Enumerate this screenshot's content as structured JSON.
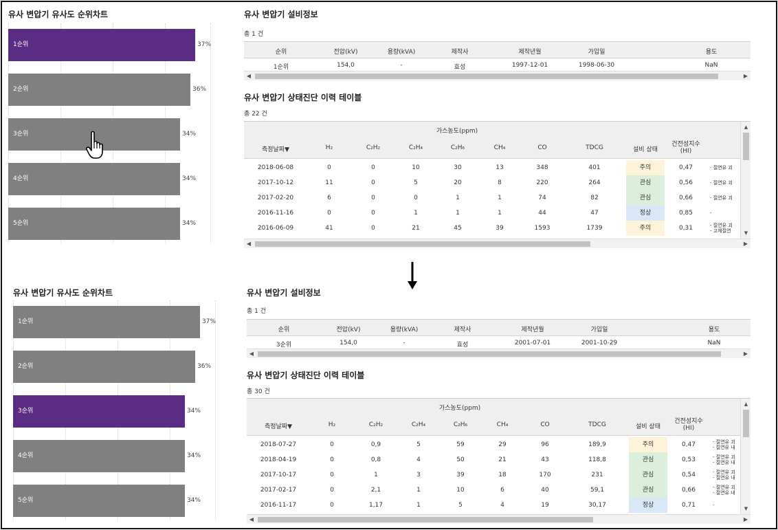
{
  "top": {
    "chart_title": "유사 변압기 유사도 순위차트",
    "chart": [
      {
        "label": "1순위",
        "pct": "37%",
        "value": 37,
        "selected": true
      },
      {
        "label": "2순위",
        "pct": "36%",
        "value": 36,
        "selected": false
      },
      {
        "label": "3순위",
        "pct": "34%",
        "value": 34,
        "selected": false
      },
      {
        "label": "4순위",
        "pct": "34%",
        "value": 34,
        "selected": false
      },
      {
        "label": "5순위",
        "pct": "34%",
        "value": 34,
        "selected": false
      }
    ],
    "info_title": "유사 변압기 설비정보",
    "info_count": "총 1 건",
    "info_headers": [
      "순위",
      "전압(kV)",
      "용량(kVA)",
      "제작사",
      "제작년월",
      "가입일",
      "용도"
    ],
    "info_row": [
      "1순위",
      "154,0",
      "-",
      "효성",
      "1997-12-01",
      "1998-06-30",
      "NaN"
    ],
    "diag_title": "유사 변압기 상태진단 이력 테이블",
    "diag_count": "총 22 건",
    "rows": [
      {
        "date": "2018-06-08",
        "h2": "0",
        "c2h2": "0",
        "c2h4": "10",
        "c2h6": "30",
        "ch4": "13",
        "co": "348",
        "tdcg": "401",
        "status": "주의",
        "hi": "0,47",
        "note": [
          "- 절연유 괴"
        ]
      },
      {
        "date": "2017-10-12",
        "h2": "11",
        "c2h2": "0",
        "c2h4": "5",
        "c2h6": "20",
        "ch4": "8",
        "co": "220",
        "tdcg": "264",
        "status": "관심",
        "hi": "0,56",
        "note": [
          "- 절연유 괴"
        ]
      },
      {
        "date": "2017-02-20",
        "h2": "6",
        "c2h2": "0",
        "c2h4": "0",
        "c2h6": "1",
        "ch4": "1",
        "co": "74",
        "tdcg": "82",
        "status": "관심",
        "hi": "0,66",
        "note": [
          "- 절연유 괴"
        ]
      },
      {
        "date": "2016-11-16",
        "h2": "0",
        "c2h2": "0",
        "c2h4": "1",
        "c2h6": "1",
        "ch4": "1",
        "co": "44",
        "tdcg": "47",
        "status": "정상",
        "hi": "0,85",
        "note": [
          "-"
        ]
      },
      {
        "date": "2016-06-09",
        "h2": "41",
        "c2h2": "0",
        "c2h4": "21",
        "c2h6": "45",
        "ch4": "39",
        "co": "1593",
        "tdcg": "1739",
        "status": "주의",
        "hi": "0,31",
        "note": [
          "- 절연유 괴",
          "- 고체절연"
        ]
      }
    ]
  },
  "bottom": {
    "chart_title": "유사 변압기 유사도 순위차트",
    "chart": [
      {
        "label": "1순위",
        "pct": "37%",
        "value": 37,
        "selected": false
      },
      {
        "label": "2순위",
        "pct": "36%",
        "value": 36,
        "selected": false
      },
      {
        "label": "3순위",
        "pct": "34%",
        "value": 34,
        "selected": true
      },
      {
        "label": "4순위",
        "pct": "34%",
        "value": 34,
        "selected": false
      },
      {
        "label": "5순위",
        "pct": "34%",
        "value": 34,
        "selected": false
      }
    ],
    "info_title": "유사 변압기 설비정보",
    "info_count": "총 1 건",
    "info_headers": [
      "순위",
      "전압(kV)",
      "용량(kVA)",
      "제작사",
      "제작년월",
      "가입일",
      "용도"
    ],
    "info_row": [
      "3순위",
      "154,0",
      "-",
      "효성",
      "2001-07-01",
      "2001-10-29",
      "NaN"
    ],
    "diag_title": "유사 변압기 상태진단 이력 테이블",
    "diag_count": "총 30 건",
    "rows": [
      {
        "date": "2018-07-27",
        "h2": "0",
        "c2h2": "0,9",
        "c2h4": "5",
        "c2h6": "59",
        "ch4": "29",
        "co": "96",
        "tdcg": "189,9",
        "status": "주의",
        "hi": "0,47",
        "note": [
          "- 절연유 괴",
          "- 절연유 내"
        ]
      },
      {
        "date": "2018-04-19",
        "h2": "0",
        "c2h2": "0,8",
        "c2h4": "4",
        "c2h6": "50",
        "ch4": "21",
        "co": "43",
        "tdcg": "118,8",
        "status": "관심",
        "hi": "0,53",
        "note": [
          "- 절연유 괴",
          "- 절연유 내"
        ]
      },
      {
        "date": "2017-10-17",
        "h2": "0",
        "c2h2": "1",
        "c2h4": "3",
        "c2h6": "39",
        "ch4": "18",
        "co": "170",
        "tdcg": "231",
        "status": "관심",
        "hi": "0,54",
        "note": [
          "- 절연유 괴",
          "- 절연유 내"
        ]
      },
      {
        "date": "2017-02-17",
        "h2": "0",
        "c2h2": "2,1",
        "c2h4": "1",
        "c2h6": "10",
        "ch4": "6",
        "co": "40",
        "tdcg": "59,1",
        "status": "관심",
        "hi": "0,66",
        "note": [
          "- 절연유 괴",
          "- 절연유 내"
        ]
      },
      {
        "date": "2016-11-17",
        "h2": "0",
        "c2h2": "1,17",
        "c2h4": "1",
        "c2h6": "5",
        "ch4": "4",
        "co": "19",
        "tdcg": "30,17",
        "status": "정상",
        "hi": "0,71",
        "note": [
          "-"
        ]
      }
    ]
  },
  "diag_headers": {
    "gas_group": "가스농도(ppm)",
    "date": "측정날짜▼",
    "h2": "H₂",
    "c2h2": "C₂H₂",
    "c2h4": "C₂H₄",
    "c2h6": "C₂H₆",
    "ch4": "CH₄",
    "co": "CO",
    "tdcg": "TDCG",
    "status": "설비 상태",
    "hi_line1": "건전성지수",
    "hi_line2": "(HI)"
  },
  "status_colors": {
    "주의": "#fdf3d8",
    "관심": "#dcefdc",
    "정상": "#d8e8f8"
  },
  "accent_color": "#5b2c83",
  "bar_color": "#808080"
}
